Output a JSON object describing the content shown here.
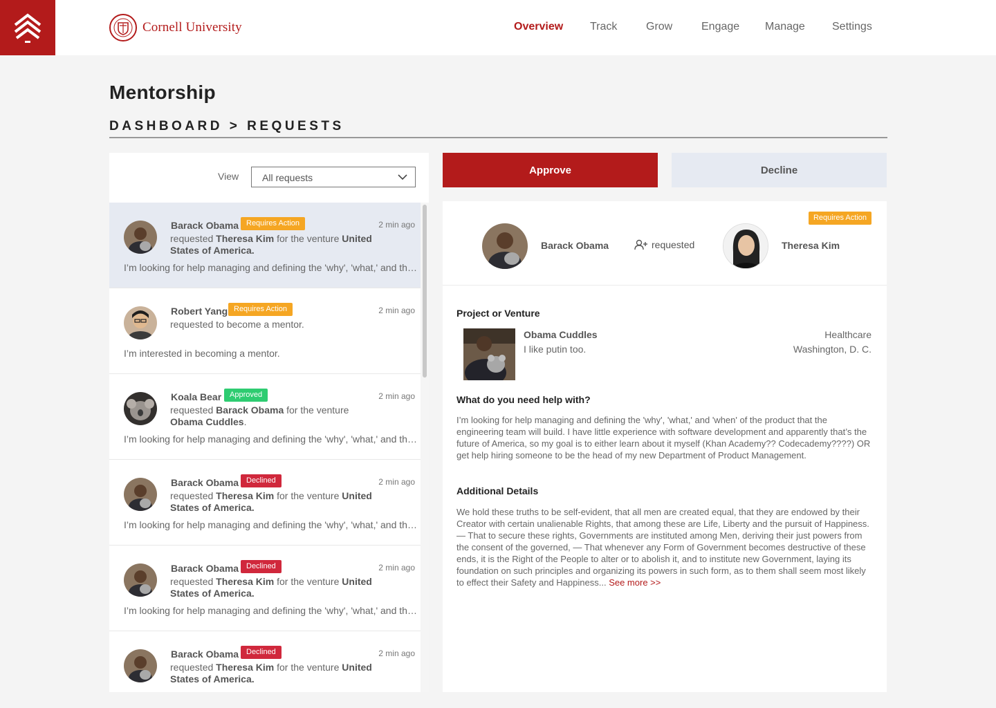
{
  "brand": {
    "name": "Cornell University"
  },
  "nav": [
    {
      "label": "Overview",
      "active": true
    },
    {
      "label": "Track"
    },
    {
      "label": "Grow"
    },
    {
      "label": "Engage"
    },
    {
      "label": "Manage"
    },
    {
      "label": "Settings"
    }
  ],
  "page": {
    "title": "Mentorship",
    "breadcrumb": "DASHBOARD > REQUESTS"
  },
  "filter": {
    "label": "View",
    "value": "All requests"
  },
  "requests": [
    {
      "name": "Barack Obama",
      "badge": "Requires Action",
      "badge_color": "#f5a623",
      "time": "2 min ago",
      "line1_pre": "requested ",
      "line1_bold": "Theresa Kim",
      "line1_post": " for the venture ",
      "line1_end": "United",
      "line2": "States of America.",
      "message": "I’m looking for help managing and defining the 'why', 'what,' and the 'when' of the product",
      "avatar": "obama"
    },
    {
      "name": "Robert Yang",
      "badge": "Requires Action",
      "badge_color": "#f5a623",
      "time": "2 min ago",
      "line1_pre": "requested to become a mentor.",
      "line1_bold": "",
      "line1_post": "",
      "line1_end": "",
      "line2": "",
      "message": "I’m interested in becoming a mentor.",
      "avatar": "yang"
    },
    {
      "name": "Koala Bear",
      "badge": "Approved",
      "badge_color": "#2ecc71",
      "time": "2 min ago",
      "line1_pre": "requested ",
      "line1_bold": "Barack Obama",
      "line1_post": " for the venture",
      "line1_end": "",
      "line2": "Obama Cuddles",
      "message": "I’m looking for help managing and defining the 'why', 'what,' and the 'when' of the product",
      "avatar": "koala"
    },
    {
      "name": "Barack Obama",
      "badge": "Declined",
      "badge_color": "#d0283c",
      "time": "2 min ago",
      "line1_pre": "requested ",
      "line1_bold": "Theresa Kim",
      "line1_post": " for the venture ",
      "line1_end": "United",
      "line2": "States of America.",
      "message": "I’m looking for help managing and defining the 'why', 'what,' and the 'when' of the product",
      "avatar": "obama"
    },
    {
      "name": "Barack Obama",
      "badge": "Declined",
      "badge_color": "#d0283c",
      "time": "2 min ago",
      "line1_pre": "requested ",
      "line1_bold": "Theresa Kim",
      "line1_post": " for the venture ",
      "line1_end": "United",
      "line2": "States of America.",
      "message": "I’m looking for help managing and defining the 'why', 'what,' and the 'when' of the product",
      "avatar": "obama"
    },
    {
      "name": "Barack Obama",
      "badge": "Declined",
      "badge_color": "#d0283c",
      "time": "2 min ago",
      "line1_pre": "requested ",
      "line1_bold": "Theresa Kim",
      "line1_post": " for the venture ",
      "line1_end": "United",
      "line2": "States of America.",
      "message": "",
      "avatar": "obama"
    }
  ],
  "actions": {
    "approve": "Approve",
    "decline": "Decline"
  },
  "detail": {
    "badge": "Requires Action",
    "requester": "Barack Obama",
    "action": "requested",
    "mentor": "Theresa Kim",
    "project_title": "Project or Venture",
    "venture_name": "Obama Cuddles",
    "venture_desc": "I like putin too.",
    "venture_category": "Healthcare",
    "venture_location": "Washington, D. C.",
    "help_title": "What do you need help with?",
    "help_text": "I’m looking for help managing and defining the 'why', 'what,' and 'when' of the product that the engineering team will build. I have little experience with software development and apparently that’s the future of America, so my goal is to either learn about it myself (Khan Academy?? Codecademy????) OR get help hiring someone to be the head of my new Department of Product Management.",
    "details_title": "Additional Details",
    "details_text": "We hold these truths to be self-evident, that all men are created equal, that they are endowed by their Creator with certain unalienable Rights, that among these are Life, Liberty and the pursuit of Happiness. — That to secure these rights, Governments are instituted among Men, deriving their just powers from the consent of the governed, — That whenever any Form of Government becomes destructive of these ends, it is the Right of the People to alter or to abolish it, and to institute new Government, laying its foundation on such principles and organizing its powers in such form, as to them shall seem most likely to effect their Safety and Happiness...",
    "see_more": "See more >>"
  },
  "colors": {
    "brand": "#b31b1b",
    "requires_action": "#f5a623",
    "approved": "#2ecc71",
    "declined": "#d0283c"
  }
}
